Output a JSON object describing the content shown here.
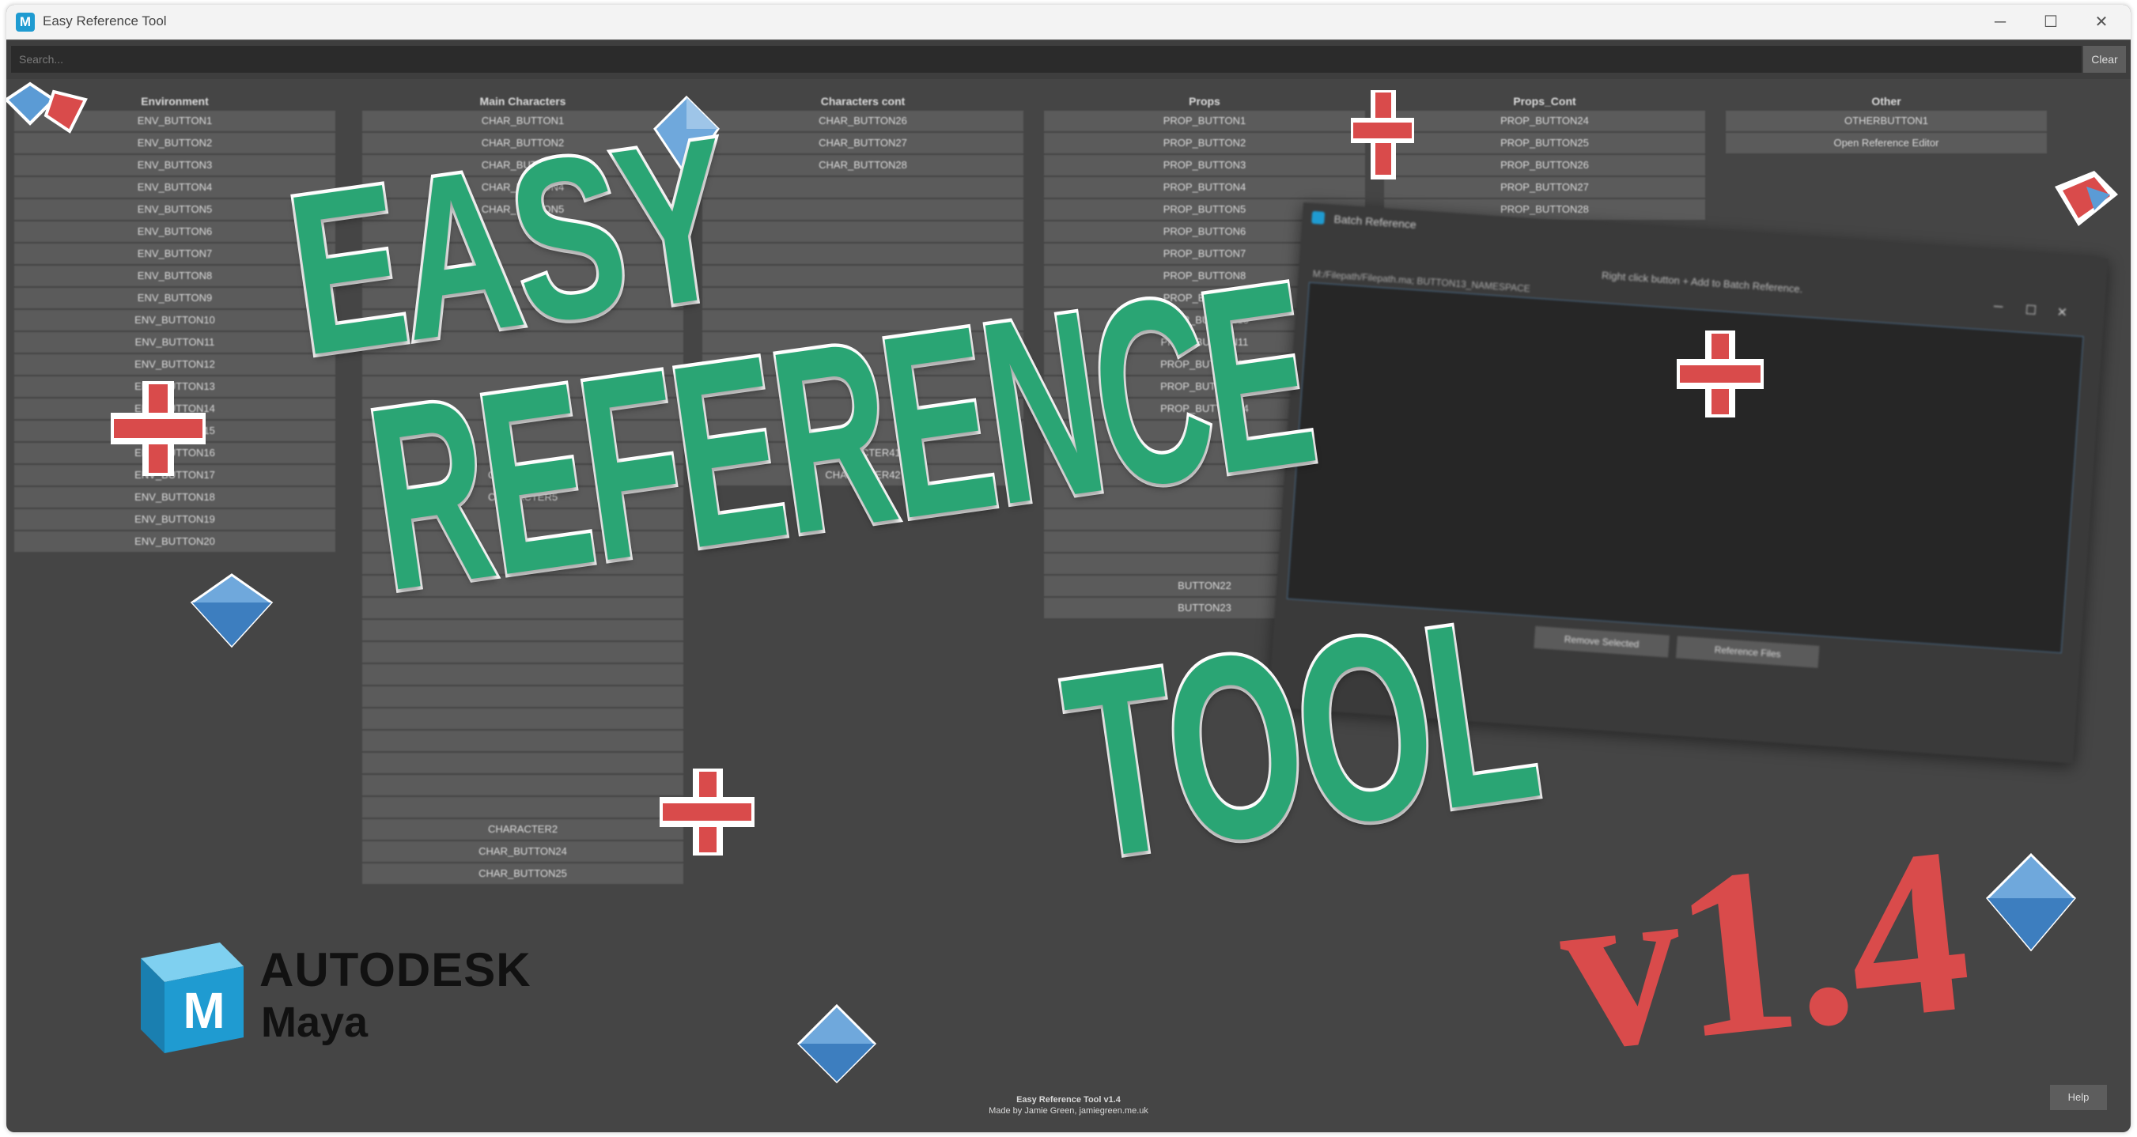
{
  "window": {
    "title": "Easy Reference Tool",
    "icon_letter": "M",
    "minimize": "─",
    "maximize": "☐",
    "close": "✕"
  },
  "search": {
    "placeholder": "Search...",
    "clear_label": "Clear"
  },
  "columns": [
    {
      "header": "Environment",
      "buttons": [
        "ENV_BUTTON1",
        "ENV_BUTTON2",
        "ENV_BUTTON3",
        "ENV_BUTTON4",
        "ENV_BUTTON5",
        "ENV_BUTTON6",
        "ENV_BUTTON7",
        "ENV_BUTTON8",
        "ENV_BUTTON9",
        "ENV_BUTTON10",
        "ENV_BUTTON11",
        "ENV_BUTTON12",
        "ENV_BUTTON13",
        "ENV_BUTTON14",
        "ENV_BUTTON15",
        "ENV_BUTTON16",
        "ENV_BUTTON17",
        "ENV_BUTTON18",
        "ENV_BUTTON19",
        "ENV_BUTTON20"
      ]
    },
    {
      "header": "Main Characters",
      "buttons": [
        "CHAR_BUTTON1",
        "CHAR_BUTTON2",
        "CHAR_BUTTON3",
        "CHAR_BUTTON4",
        "CHAR_BUTTON5",
        "",
        "",
        "",
        "",
        "",
        "",
        "",
        "",
        "",
        "",
        "",
        "CHARACTER4",
        "CHARACTER5",
        "",
        "",
        "",
        "",
        "",
        "",
        "",
        "",
        "",
        "",
        "",
        "",
        "",
        "",
        "CHARACTER2",
        "CHAR_BUTTON24",
        "CHAR_BUTTON25"
      ]
    },
    {
      "header": "Characters cont",
      "buttons": [
        "CHAR_BUTTON26",
        "CHAR_BUTTON27",
        "CHAR_BUTTON28",
        "",
        "",
        "",
        "",
        "",
        "",
        "",
        "",
        "",
        "",
        "",
        "",
        "CHARACTER41",
        "CHARACTER42"
      ]
    },
    {
      "header": "Props",
      "buttons": [
        "PROP_BUTTON1",
        "PROP_BUTTON2",
        "PROP_BUTTON3",
        "PROP_BUTTON4",
        "PROP_BUTTON5",
        "PROP_BUTTON6",
        "PROP_BUTTON7",
        "PROP_BUTTON8",
        "PROP_BUTTON9",
        "PROP_BUTTON10",
        "PROP_BUTTON11",
        "PROP_BUTTON12",
        "PROP_BUTTON13",
        "PROP_BUTTON14",
        "",
        "",
        "",
        "",
        "",
        "",
        "",
        "BUTTON22",
        "BUTTON23"
      ]
    },
    {
      "header": "Props_Cont",
      "buttons": [
        "PROP_BUTTON24",
        "PROP_BUTTON25",
        "PROP_BUTTON26",
        "PROP_BUTTON27",
        "PROP_BUTTON28"
      ]
    },
    {
      "header": "Other",
      "buttons": [
        "OTHERBUTTON1",
        "Open Reference Editor"
      ]
    }
  ],
  "batch": {
    "title": "Batch Reference",
    "hint": "Right click button + Add to Batch Reference.",
    "path": "M:/Filepath/Filepath.ma; BUTTON13_NAMESPACE",
    "btn_remove": "Remove Selected",
    "btn_reference": "Reference Files"
  },
  "footer": {
    "line1": "Easy Reference Tool v1.4",
    "line2": "Made by Jamie Green, jamiegreen.me.uk",
    "help_label": "Help"
  },
  "overlay": {
    "line1": "EASY",
    "line2": "REFERENCE",
    "line3": "TOOL",
    "version": "v1.4"
  },
  "brand": {
    "company": "AUTODESK",
    "product": "Maya",
    "cube_letter": "M",
    "title_green": "#2aa574",
    "version_red": "#d94b4b",
    "maya_blue": "#1f9bd1"
  }
}
